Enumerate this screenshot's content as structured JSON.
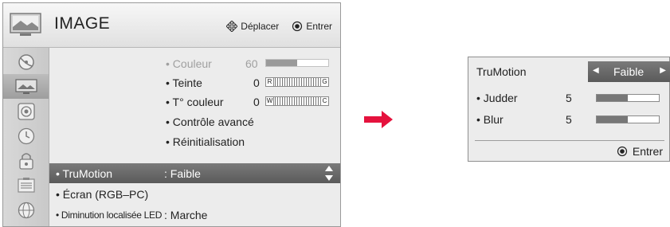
{
  "menu": {
    "title": "IMAGE",
    "hints": {
      "move": "Déplacer",
      "enter": "Entrer"
    },
    "sidebar": [
      {
        "icon": "satellite-dish-icon",
        "active": false
      },
      {
        "icon": "picture-icon",
        "active": true
      },
      {
        "icon": "speaker-icon",
        "active": false
      },
      {
        "icon": "clock-icon",
        "active": false
      },
      {
        "icon": "lock-icon",
        "active": false
      },
      {
        "icon": "option-icon",
        "active": false
      },
      {
        "icon": "network-icon",
        "active": false
      }
    ],
    "rows": [
      {
        "label": "• Couleur",
        "value": "60",
        "level": 0.5
      },
      {
        "label": "• Teinte",
        "value": "0",
        "left": "R",
        "right": "G"
      },
      {
        "label": "• T° couleur",
        "value": "0",
        "left": "W",
        "right": "C"
      },
      {
        "label": "• Contrôle avancé"
      },
      {
        "label": "• Réinitialisation"
      },
      {
        "label": "• TruMotion",
        "value": ": Faible"
      },
      {
        "label": "• Écran (RGB–PC)"
      },
      {
        "label": "• Diminution localisée LED",
        "value": ": Marche"
      }
    ]
  },
  "trumotion": {
    "title": "TruMotion",
    "value": "Faible",
    "judder": {
      "label": "• Judder",
      "value": "5",
      "level": 0.5
    },
    "blur": {
      "label": "• Blur",
      "value": "5",
      "level": 0.5
    },
    "enter": "Entrer"
  }
}
